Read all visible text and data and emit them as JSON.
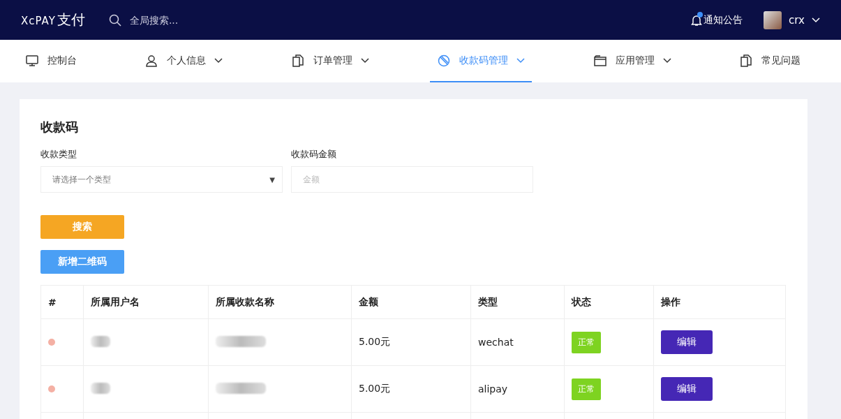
{
  "header": {
    "logo_latin": "XcPAY",
    "logo_cjk": "支付",
    "search": {
      "placeholder": "全局搜索..."
    },
    "notice": {
      "label": "通知公告",
      "unread": true
    },
    "user": {
      "name": "crx"
    }
  },
  "nav": [
    {
      "label": "控制台",
      "has_menu": false,
      "selected": false
    },
    {
      "label": "个人信息",
      "has_menu": true,
      "selected": false
    },
    {
      "label": "订单管理",
      "has_menu": true,
      "selected": false
    },
    {
      "label": "收款码管理",
      "has_menu": true,
      "selected": true
    },
    {
      "label": "应用管理",
      "has_menu": true,
      "selected": false
    },
    {
      "label": "常见问题",
      "has_menu": false,
      "selected": false
    }
  ],
  "panel": {
    "title": "收款码",
    "filters": [
      {
        "kind": "select",
        "label": "收款类型",
        "placeholder": "请选择一个类型",
        "caret": "▼"
      },
      {
        "kind": "input",
        "label": "收款码金额",
        "placeholder": "金额"
      }
    ],
    "buttons": [
      {
        "label": "搜索",
        "kind": "warning"
      },
      {
        "label": "新增二维码",
        "kind": "primary"
      }
    ],
    "table": {
      "columns": [
        "#",
        "所属用户名",
        "所属收款名称",
        "金额",
        "类型",
        "状态",
        "操作"
      ],
      "rows": [
        {
          "color": "#f4b0a4",
          "amount": "5.00元",
          "type": "wechat",
          "status": "正常",
          "action": "编辑"
        },
        {
          "color": "#f4b0a4",
          "amount": "5.00元",
          "type": "alipay",
          "status": "正常",
          "action": "编辑"
        }
      ]
    }
  }
}
